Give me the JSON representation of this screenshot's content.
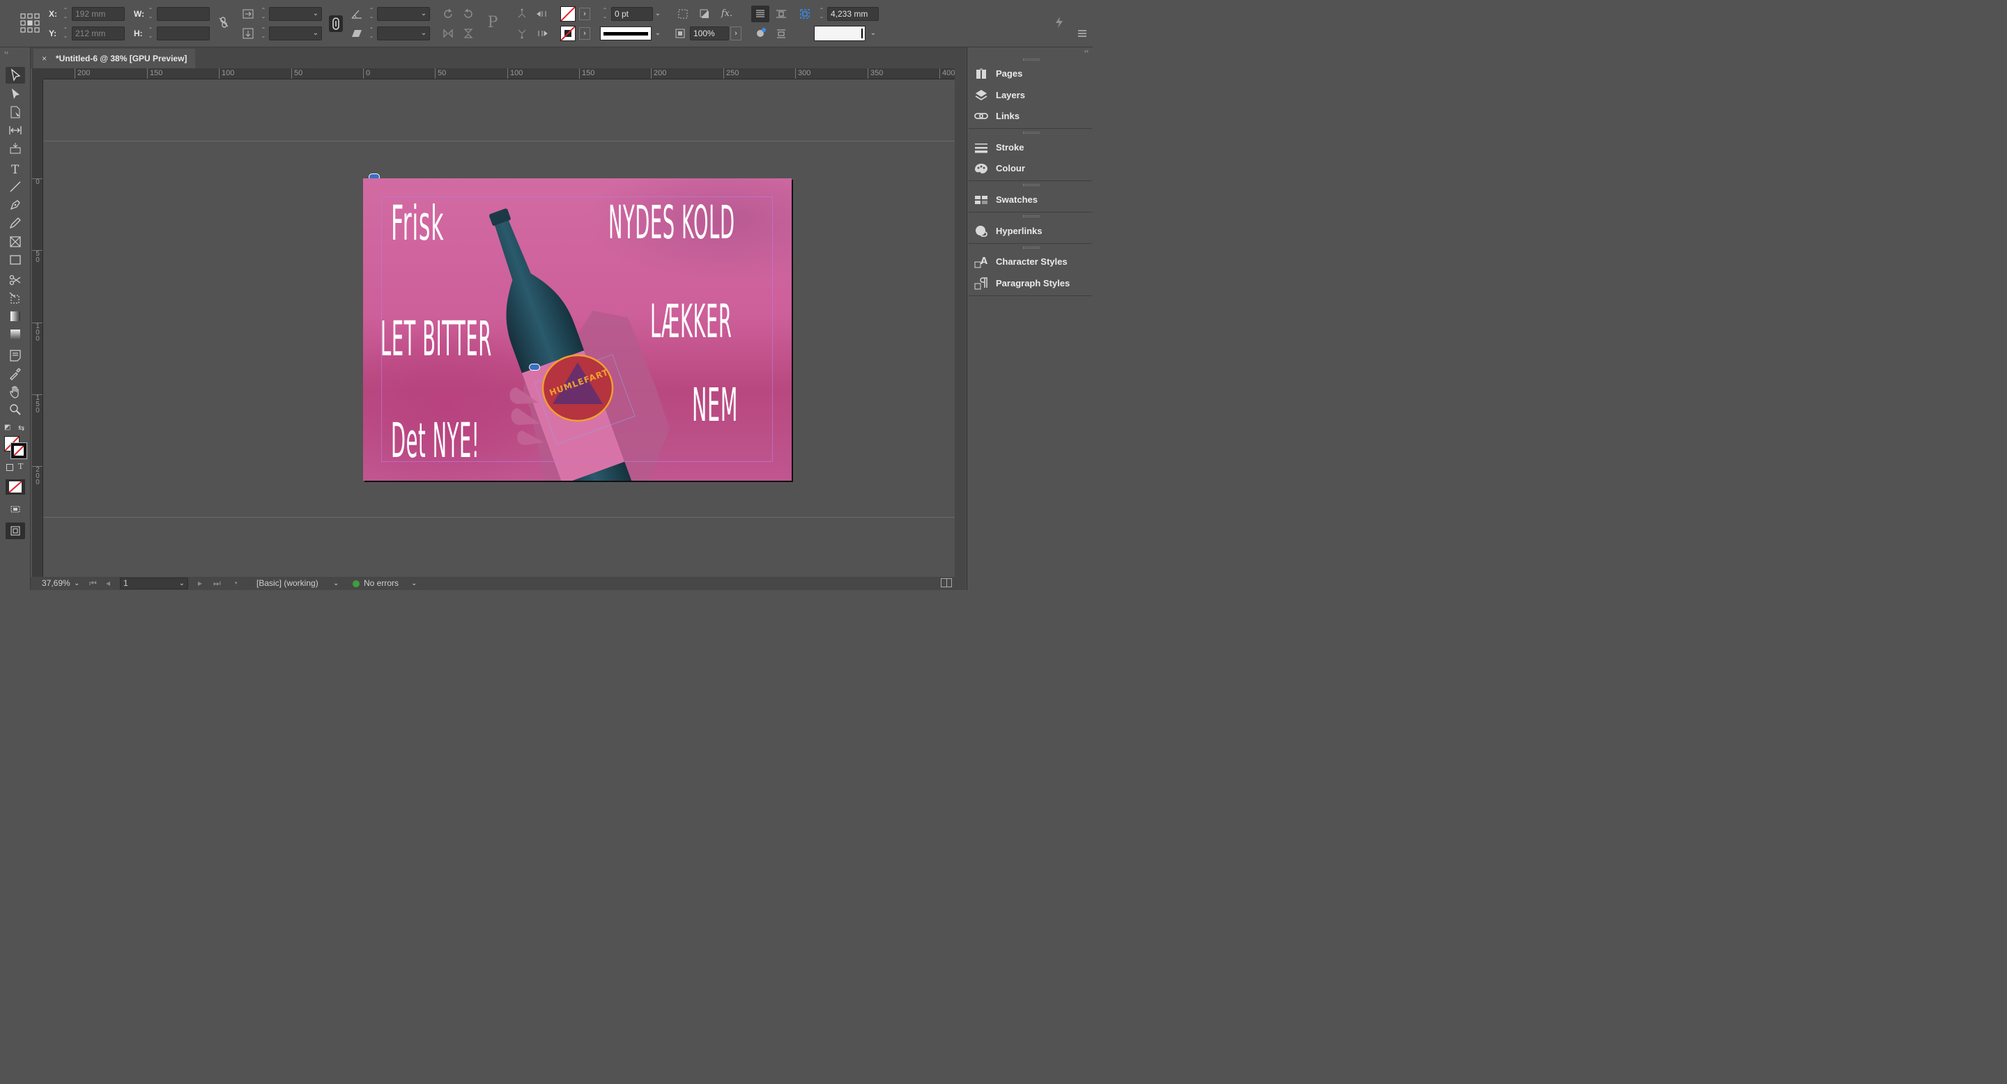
{
  "controls": {
    "x_label": "X:",
    "x_value": "192 mm",
    "y_label": "Y:",
    "y_value": "212 mm",
    "w_label": "W:",
    "w_value": "",
    "h_label": "H:",
    "h_value": "",
    "stroke_weight": "0 pt",
    "opacity": "100%",
    "gutter": "4,233 mm"
  },
  "document": {
    "tab_title": "*Untitled-6 @ 38% [GPU Preview]",
    "close_glyph": "×",
    "ruler_h": [
      "200",
      "150",
      "100",
      "50",
      "0",
      "50",
      "100",
      "150",
      "200",
      "250",
      "300",
      "350",
      "400"
    ],
    "ruler_v": [
      "0",
      "5\n0",
      "1\n0\n0",
      "1\n5\n0",
      "2\n0\n0"
    ],
    "headlines": {
      "frisk": "Frisk",
      "nydes_kold": "NYDES KOLD",
      "let_bitter": "LET BITTER",
      "laekker": "LÆKKER",
      "nem": "NEM",
      "det_nye": "Det NYE!"
    },
    "logo_text": "HUMLEFART"
  },
  "status": {
    "zoom": "37,69%",
    "page": "1",
    "preflight_profile": "[Basic] (working)",
    "errors": "No errors"
  },
  "panels": [
    {
      "label": "Pages",
      "icon": "pages-icon"
    },
    {
      "label": "Layers",
      "icon": "layers-icon"
    },
    {
      "label": "Links",
      "icon": "links-icon"
    },
    {
      "label": "Stroke",
      "icon": "stroke-icon"
    },
    {
      "label": "Colour",
      "icon": "colour-icon"
    },
    {
      "label": "Swatches",
      "icon": "swatches-icon"
    },
    {
      "label": "Hyperlinks",
      "icon": "hyperlinks-icon"
    },
    {
      "label": "Character Styles",
      "icon": "character-styles-icon"
    },
    {
      "label": "Paragraph Styles",
      "icon": "paragraph-styles-icon"
    }
  ],
  "colors": {
    "page_pink": "#cd5f9a",
    "bottle_teal": "#1f4a5a",
    "logo_red": "#b5343f",
    "logo_orange": "#f0a030",
    "logo_triangle": "#6a2f6a"
  }
}
